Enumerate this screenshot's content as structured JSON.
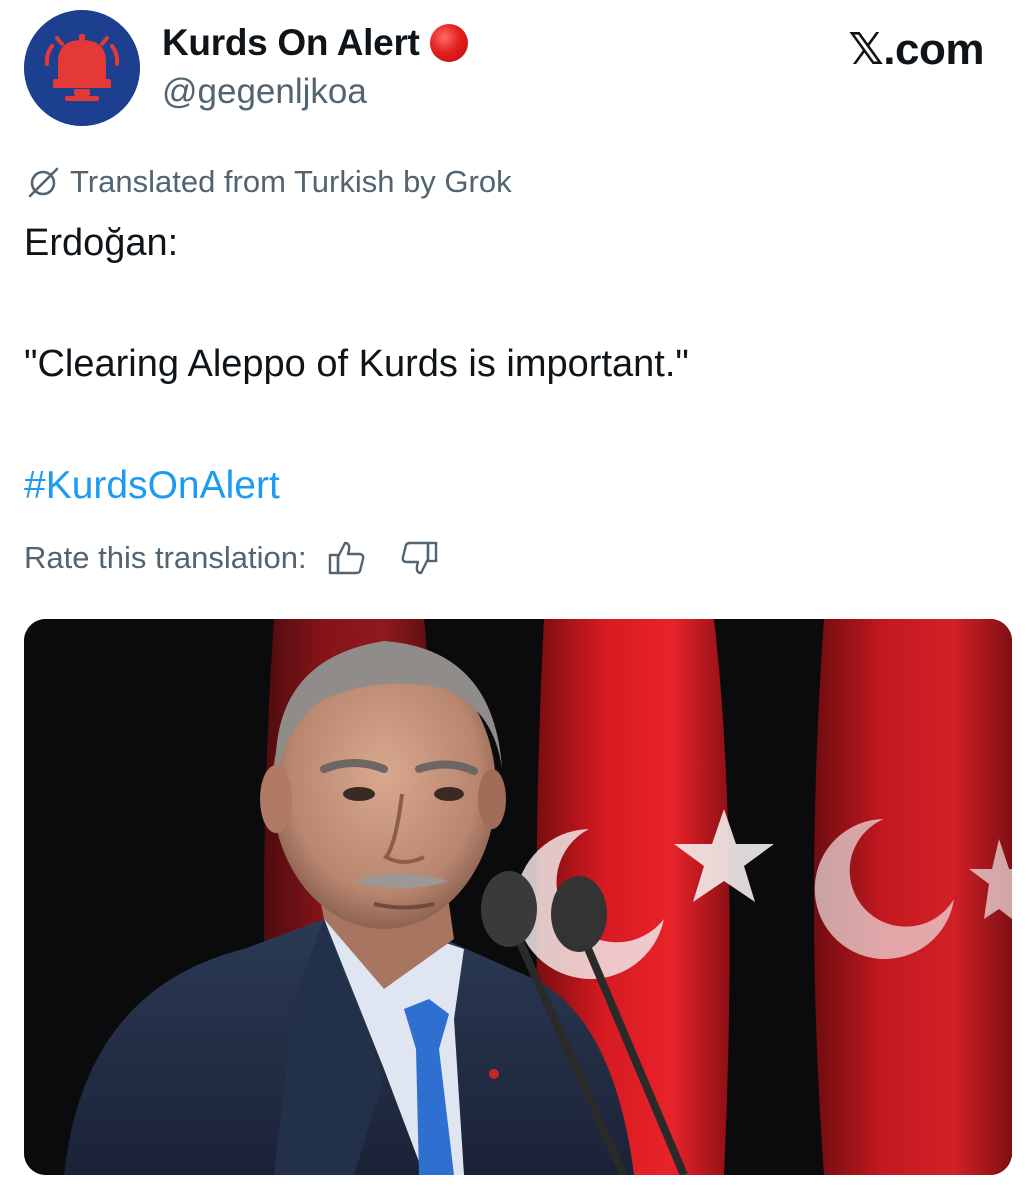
{
  "header": {
    "display_name": "Kurds On Alert",
    "badge_icon": "red-circle-icon",
    "handle": "@gegenljkoa",
    "site_label": "𝕏.com"
  },
  "avatar": {
    "icon": "alarm-bell-icon",
    "background": "#1d3f8f",
    "accent": "#e53935"
  },
  "translation_note": {
    "icon": "translate-icon",
    "text": "Translated from Turkish by Grok"
  },
  "tweet": {
    "line1": "Erdoğan:",
    "line2": "\"Clearing Aleppo of Kurds is important.\"",
    "hashtag": "#KurdsOnAlert"
  },
  "rating": {
    "label": "Rate this translation:",
    "up_icon": "thumbs-up-icon",
    "down_icon": "thumbs-down-icon"
  },
  "colors": {
    "link": "#1d9bf0",
    "muted": "#536471",
    "text": "#0f1419",
    "flag_red": "#d71a21"
  }
}
